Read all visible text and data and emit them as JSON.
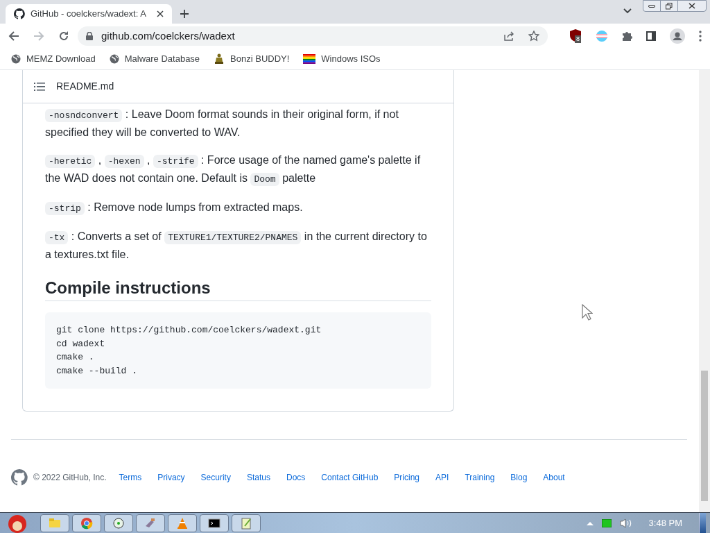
{
  "tab": {
    "title": "GitHub - coelckers/wadext: A",
    "selected": true
  },
  "address": "github.com/coelckers/wadext",
  "extension_badge": "8",
  "bookmarks": [
    {
      "label": "MEMZ Download",
      "kind": "globe"
    },
    {
      "label": "Malware Database",
      "kind": "globe"
    },
    {
      "label": "Bonzi BUDDY!",
      "kind": "figure"
    },
    {
      "label": "Windows ISOs",
      "kind": "flag"
    }
  ],
  "readme": {
    "title": "README.md",
    "paragraphs": [
      [
        {
          "kind": "code",
          "text": "-nosndconvert"
        },
        {
          "kind": "text",
          "text": " : Leave Doom format sounds in their original form, if not specified they will be converted to WAV."
        }
      ],
      [
        {
          "kind": "code",
          "text": "-heretic"
        },
        {
          "kind": "text",
          "text": " , "
        },
        {
          "kind": "code",
          "text": "-hexen"
        },
        {
          "kind": "text",
          "text": " , "
        },
        {
          "kind": "code",
          "text": "-strife"
        },
        {
          "kind": "text",
          "text": " : Force usage of the named game's palette if the WAD does not contain one. Default is "
        },
        {
          "kind": "code",
          "text": "Doom"
        },
        {
          "kind": "text",
          "text": " palette"
        }
      ],
      [
        {
          "kind": "code",
          "text": "-strip"
        },
        {
          "kind": "text",
          "text": " : Remove node lumps from extracted maps."
        }
      ],
      [
        {
          "kind": "code",
          "text": "-tx"
        },
        {
          "kind": "text",
          "text": " : Converts a set of "
        },
        {
          "kind": "code",
          "text": "TEXTURE1/TEXTURE2/PNAMES"
        },
        {
          "kind": "text",
          "text": " in the current directory to a textures.txt file."
        }
      ]
    ],
    "heading": "Compile instructions",
    "code_lines": [
      "git clone https://github.com/coelckers/wadext.git",
      "cd wadext",
      "cmake .",
      "cmake --build ."
    ]
  },
  "footer": {
    "copyright": "© 2022 GitHub, Inc.",
    "links": [
      "Terms",
      "Privacy",
      "Security",
      "Status",
      "Docs",
      "Contact GitHub",
      "Pricing",
      "API",
      "Training",
      "Blog",
      "About"
    ]
  },
  "taskbar": {
    "apps": [
      {
        "kind": "folder"
      },
      {
        "kind": "browser"
      },
      {
        "kind": "disc"
      },
      {
        "kind": "tools"
      },
      {
        "kind": "cone"
      },
      {
        "kind": "console"
      },
      {
        "kind": "notepad"
      }
    ],
    "clock": "3:48 PM"
  }
}
